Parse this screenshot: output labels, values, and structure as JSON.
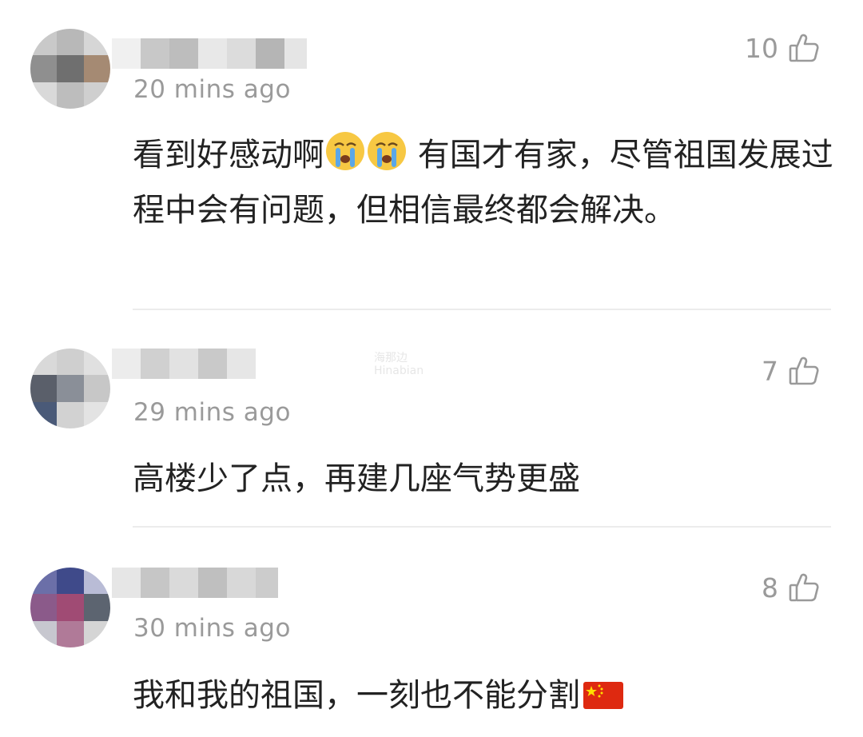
{
  "comments": [
    {
      "time": "20 mins ago",
      "likes": "10",
      "text": "看到好感动啊",
      "text_after": " 有国才有家，尽管祖国发展过程中会有问题，但相信最终都会解决。",
      "emoji": "crying-face-icon"
    },
    {
      "time": "29 mins ago",
      "likes": "7",
      "text": "高楼少了点，再建几座气势更盛"
    },
    {
      "time": "30 mins ago",
      "likes": "8",
      "text": "我和我的祖国，一刻也不能分割",
      "emoji": "china-flag-icon"
    }
  ],
  "watermark": {
    "line1": "海那边",
    "line2": "Hinabian"
  },
  "colors": {
    "meta_gray": "#9a9a9a",
    "text": "#222222",
    "divider": "#ececec"
  }
}
